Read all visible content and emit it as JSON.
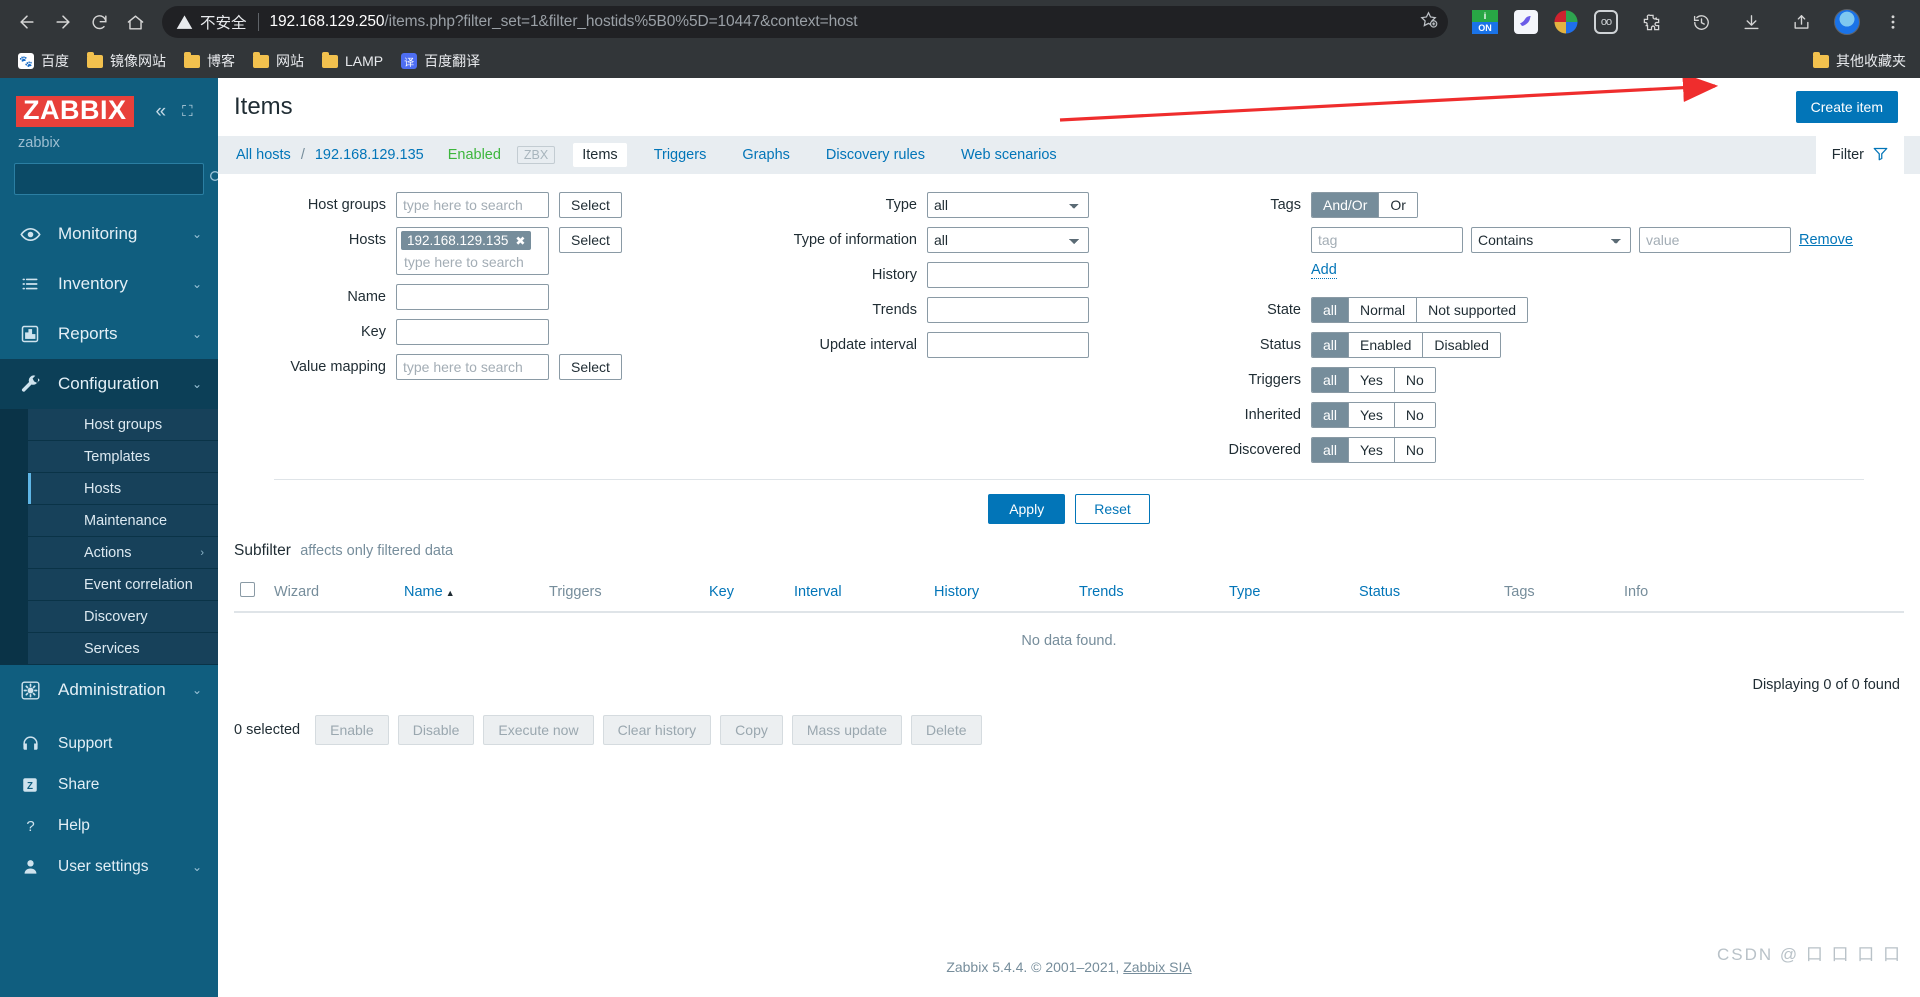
{
  "browser": {
    "nav": {
      "back": "back-arrow",
      "forward": "forward-arrow",
      "reload": "reload",
      "home": "home"
    },
    "security_label": "不安全",
    "url_host": "192.168.129.250",
    "url_path": "/items.php?filter_set=1&filter_hostids%5B0%5D=10447&context=host",
    "bookmarks": [
      {
        "label": "百度",
        "icon": "baidu-icon"
      },
      {
        "label": "镜像网站",
        "icon": "folder-icon"
      },
      {
        "label": "博客",
        "icon": "folder-icon"
      },
      {
        "label": "网站",
        "icon": "folder-icon"
      },
      {
        "label": "LAMP",
        "icon": "folder-icon"
      },
      {
        "label": "百度翻译",
        "icon": "fanyi-icon"
      }
    ],
    "bookmarks_right": {
      "label": "其他收藏夹",
      "icon": "folder-icon"
    },
    "extensions": [
      "on-badge-icon",
      "bird-icon",
      "idm-icon",
      "oo-icon",
      "puzzle-icon",
      "history-icon",
      "download-icon",
      "share-icon",
      "avatar",
      "more-icon"
    ]
  },
  "sidebar": {
    "logo": "ZABBIX",
    "user": "zabbix",
    "search_placeholder": "",
    "items": [
      {
        "label": "Monitoring",
        "icon": "eye-icon",
        "has_arrow": true
      },
      {
        "label": "Inventory",
        "icon": "list-icon",
        "has_arrow": true
      },
      {
        "label": "Reports",
        "icon": "bar-chart-icon",
        "has_arrow": true
      },
      {
        "label": "Configuration",
        "icon": "wrench-icon",
        "has_arrow": true,
        "active": true
      },
      {
        "label": "Administration",
        "icon": "gear-icon",
        "has_arrow": true
      }
    ],
    "submenu": [
      {
        "label": "Host groups"
      },
      {
        "label": "Templates"
      },
      {
        "label": "Hosts",
        "current": true
      },
      {
        "label": "Maintenance"
      },
      {
        "label": "Actions",
        "has_arrow": true
      },
      {
        "label": "Event correlation"
      },
      {
        "label": "Discovery"
      },
      {
        "label": "Services"
      }
    ],
    "bottom": [
      {
        "label": "Support",
        "icon": "headset-icon"
      },
      {
        "label": "Share",
        "icon": "zabbix-z-icon"
      },
      {
        "label": "Help",
        "icon": "question-icon"
      },
      {
        "label": "User settings",
        "icon": "user-icon"
      }
    ]
  },
  "header": {
    "title": "Items",
    "create_button": "Create item"
  },
  "breadcrumb": {
    "all_hosts": "All hosts",
    "separator": "/",
    "host": "192.168.129.135",
    "enabled": "Enabled",
    "zbx": "ZBX",
    "tabs": [
      {
        "label": "Items",
        "selected": true
      },
      {
        "label": "Triggers",
        "selected": false
      },
      {
        "label": "Graphs",
        "selected": false
      },
      {
        "label": "Discovery rules",
        "selected": false
      },
      {
        "label": "Web scenarios",
        "selected": false
      }
    ],
    "filter_tab": "Filter"
  },
  "filter": {
    "host_groups": {
      "label": "Host groups",
      "placeholder": "type here to search",
      "value": "",
      "select_button": "Select"
    },
    "hosts": {
      "label": "Hosts",
      "chip": "192.168.129.135",
      "placeholder": "type here to search",
      "select_button": "Select"
    },
    "name": {
      "label": "Name",
      "value": ""
    },
    "key": {
      "label": "Key",
      "value": ""
    },
    "value_mapping": {
      "label": "Value mapping",
      "placeholder": "type here to search",
      "value": "",
      "select_button": "Select"
    },
    "type": {
      "label": "Type",
      "value": "all"
    },
    "type_of_information": {
      "label": "Type of information",
      "value": "all"
    },
    "history": {
      "label": "History",
      "value": ""
    },
    "trends": {
      "label": "Trends",
      "value": ""
    },
    "update_interval": {
      "label": "Update interval",
      "value": ""
    },
    "tags": {
      "label": "Tags",
      "mode_options": [
        "And/Or",
        "Or"
      ],
      "mode_selected": "And/Or",
      "tag_placeholder": "tag",
      "operator": "Contains",
      "value_placeholder": "value",
      "remove_label": "Remove",
      "add_label": "Add"
    },
    "state": {
      "label": "State",
      "options": [
        "all",
        "Normal",
        "Not supported"
      ],
      "selected": "all"
    },
    "status": {
      "label": "Status",
      "options": [
        "all",
        "Enabled",
        "Disabled"
      ],
      "selected": "all"
    },
    "triggers": {
      "label": "Triggers",
      "options": [
        "all",
        "Yes",
        "No"
      ],
      "selected": "all"
    },
    "inherited": {
      "label": "Inherited",
      "options": [
        "all",
        "Yes",
        "No"
      ],
      "selected": "all"
    },
    "discovered": {
      "label": "Discovered",
      "options": [
        "all",
        "Yes",
        "No"
      ],
      "selected": "all"
    },
    "apply": "Apply",
    "reset": "Reset"
  },
  "subfilter": {
    "label": "Subfilter",
    "note": "affects only filtered data"
  },
  "table": {
    "columns": [
      "Wizard",
      "Name",
      "Triggers",
      "Key",
      "Interval",
      "History",
      "Trends",
      "Type",
      "Status",
      "Tags",
      "Info"
    ],
    "sorted_column": "Name",
    "sort_arrow": "▲",
    "no_data": "No data found.",
    "displaying": "Displaying 0 of 0 found",
    "rows": []
  },
  "actions": {
    "selected_count": "0 selected",
    "buttons": [
      "Enable",
      "Disable",
      "Execute now",
      "Clear history",
      "Copy",
      "Mass update",
      "Delete"
    ]
  },
  "footer": {
    "text": "Zabbix 5.4.4. © 2001–2021,",
    "link": "Zabbix SIA"
  },
  "watermark": "CSDN @ 口 口 口 口"
}
